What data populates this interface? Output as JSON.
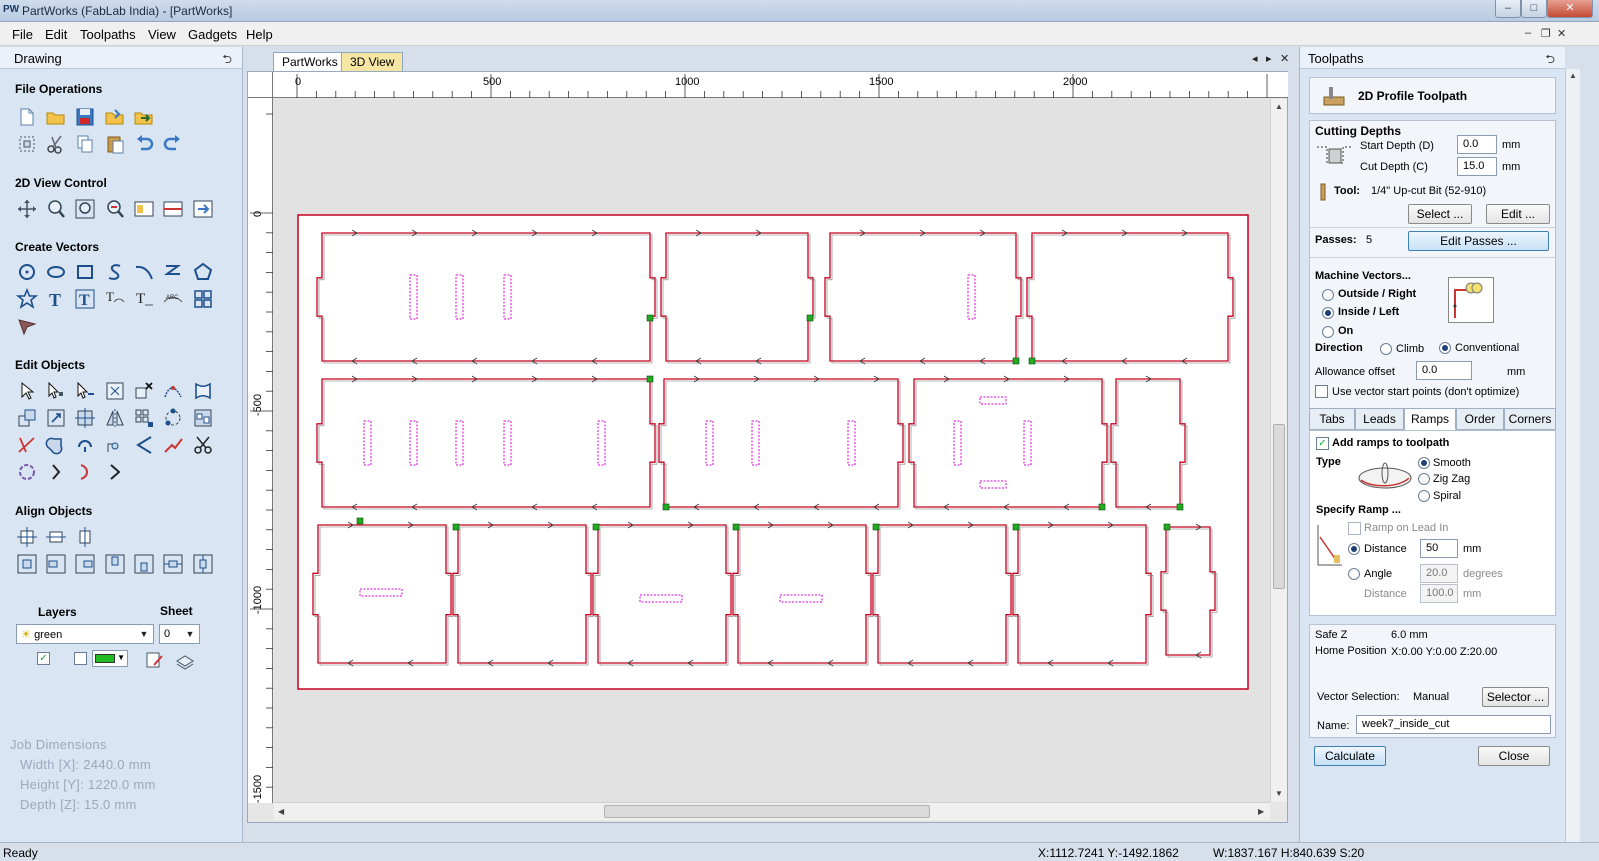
{
  "app": {
    "logo": "PW",
    "title": "PartWorks (FabLab India) - [PartWorks]",
    "controls": {
      "minimize": "–",
      "maximize": "□",
      "close": "✕"
    }
  },
  "menu": {
    "items": [
      "File",
      "Edit",
      "Toolpaths",
      "View",
      "Gadgets",
      "Help"
    ],
    "mdi_controls": {
      "minimize": "–",
      "restore": "❐",
      "close": "✕"
    }
  },
  "left_panel": {
    "title": "Drawing",
    "pin": "⮌",
    "sections": {
      "file_operations": "File Operations",
      "view_control": "2D View Control",
      "create_vectors": "Create Vectors",
      "edit_objects": "Edit Objects",
      "align_objects": "Align Objects"
    },
    "layers": {
      "label": "Layers",
      "sheet_label": "Sheet",
      "layer_value": "green",
      "sheet_value": "0",
      "layer_color": "#22bb22"
    },
    "job": {
      "title": "Job Dimensions",
      "width": "Width  [X]: 2440.0 mm",
      "height": "Height [Y]: 1220.0 mm",
      "depth": "Depth  [Z]: 15.0 mm"
    }
  },
  "doc": {
    "tabs": [
      "PartWorks",
      "3D View"
    ],
    "nav": {
      "prev": "◂",
      "next": "▸",
      "close": "✕"
    },
    "h_ruler": [
      "0",
      "500",
      "1000",
      "1500",
      "2000"
    ],
    "v_ruler": [
      "0",
      "-500",
      "-1000",
      "-1500"
    ],
    "colors": {
      "outline": "#c8001e",
      "slot": "#d800d8",
      "node": "#22aa22"
    }
  },
  "toolpaths": {
    "panel_title": "Toolpaths",
    "pin": "⮌",
    "header": "2D Profile Toolpath",
    "cutting_depths": {
      "title": "Cutting Depths",
      "start_label": "Start Depth (D)",
      "start_value": "0.0",
      "cut_label": "Cut Depth (C)",
      "cut_value": "15.0",
      "unit": "mm"
    },
    "tool": {
      "label": "Tool:",
      "value": "1/4\" Up-cut Bit (52-910)",
      "select": "Select ...",
      "edit": "Edit ..."
    },
    "passes": {
      "label": "Passes:",
      "value": "5",
      "edit": "Edit Passes ..."
    },
    "machine_vectors": {
      "title": "Machine Vectors...",
      "options": [
        "Outside / Right",
        "Inside / Left",
        "On"
      ],
      "selected": 1
    },
    "direction": {
      "label": "Direction",
      "climb": "Climb",
      "conventional": "Conventional"
    },
    "allowance": {
      "label": "Allowance offset",
      "value": "0.0",
      "unit": "mm"
    },
    "vector_start": "Use vector start points (don't optimize)",
    "tabs": [
      "Tabs",
      "Leads",
      "Ramps",
      "Order",
      "Corners"
    ],
    "ramps": {
      "add_label": "Add ramps to toolpath",
      "type_label": "Type",
      "types": [
        "Smooth",
        "Zig Zag",
        "Spiral"
      ],
      "specify": "Specify Ramp ...",
      "lead_in": "Ramp on Lead In",
      "distance_label": "Distance",
      "distance_value": "50",
      "angle_label": "Angle",
      "angle_value": "20.0",
      "angle_unit": "degrees",
      "distance2_label": "Distance",
      "distance2_value": "100.0",
      "unit": "mm"
    },
    "safe": {
      "safe_z_label": "Safe Z",
      "safe_z_value": "6.0 mm",
      "home_label": "Home Position",
      "home_value": "X:0.00 Y:0.00 Z:20.00"
    },
    "vector_selection": {
      "label": "Vector Selection:",
      "value": "Manual",
      "button": "Selector ..."
    },
    "name": {
      "label": "Name:",
      "value": "week7_inside_cut"
    },
    "calculate": "Calculate",
    "close": "Close"
  },
  "status": {
    "left": "Ready",
    "coords": "X:1112.7241 Y:-1492.1862",
    "dims": "W:1837.167  H:840.639  S:20"
  }
}
